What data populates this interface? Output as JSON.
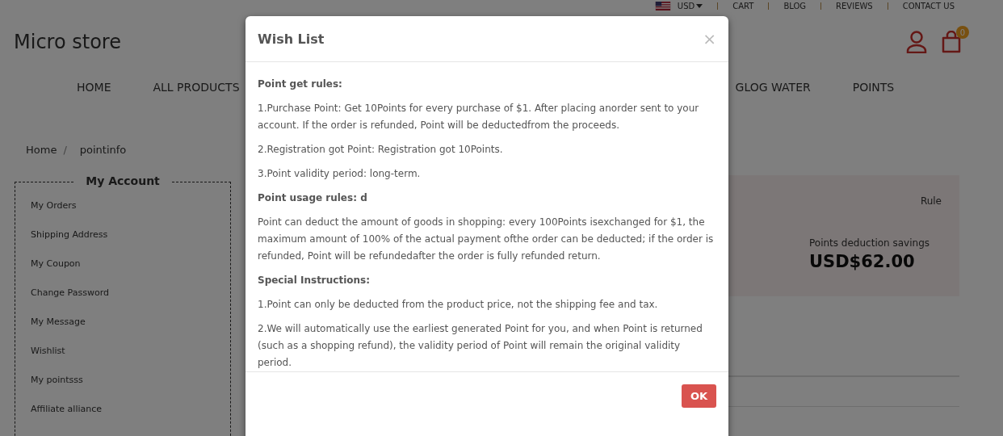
{
  "top_bar": {
    "currency": "USD",
    "links": [
      "CART",
      "BLOG",
      "REVIEWS",
      "CONTACT US"
    ]
  },
  "header": {
    "logo": "Micro store",
    "cart_count": "0"
  },
  "nav": [
    "HOME",
    "ALL PRODUCTS",
    "GLOG WATER",
    "POINTS"
  ],
  "breadcrumb": {
    "items": [
      "Home",
      "pointinfo"
    ],
    "separator": "/"
  },
  "sidebar": {
    "title": "My Account",
    "items": [
      "My Orders",
      "Shipping Address",
      "My Coupon",
      "Change Password",
      "My Message",
      "Wishlist",
      "My pointsss",
      "Affiliate alliance"
    ]
  },
  "points_panel": {
    "rule_link": "Rule",
    "savings_label": "Points deduction savings",
    "savings_value": "USD$62.00"
  },
  "modal": {
    "title": "Wish List",
    "close": "×",
    "paragraphs": [
      {
        "kind": "heading",
        "text": "Point get rules:"
      },
      {
        "kind": "text",
        "text": "1.Purchase Point: Get 10Points for every purchase of $1. After placing anorder sent to your account. If the order is refunded, Point will be deductedfrom the proceeds."
      },
      {
        "kind": "text",
        "text": "2.Registration got Point: Registration got 10Points."
      },
      {
        "kind": "text",
        "text": "3.Point validity period: long-term."
      },
      {
        "kind": "heading",
        "text": "Point usage rules: d"
      },
      {
        "kind": "text",
        "text": "Point can deduct the amount of goods in shopping: every 100Points isexchanged for $1, the maximum amount of 100% of the actual payment ofthe order can be deducted; if the order is refunded, Point will be refundedafter the order is fully refunded return."
      },
      {
        "kind": "heading",
        "text": "Special Instructions:"
      },
      {
        "kind": "text",
        "text": "1.Point can only be deducted from the product price, not the shipping fee and tax."
      },
      {
        "kind": "text",
        "text": "2.We will automatically use the earliest generated Point for you, and when Point is returned (such as a shopping refund), the validity period of Point will remain the original validity period."
      }
    ],
    "ok_button": "OK"
  }
}
